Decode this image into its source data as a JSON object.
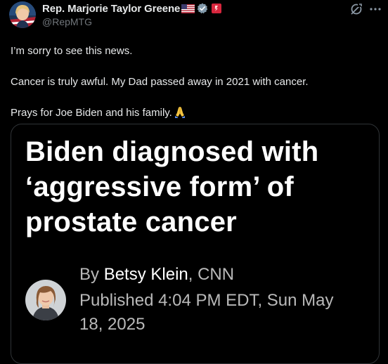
{
  "tweet": {
    "author": {
      "display_name": "Rep. Marjorie Taylor Greene",
      "handle": "@RepMTG",
      "badges": [
        "us-flag-icon",
        "verified-gray-icon",
        "government-affiliate-icon"
      ]
    },
    "actions": {
      "grok_icon": "grok-icon",
      "more_icon": "more-horizontal-icon"
    },
    "text_lines": [
      "I’m sorry to see this news.",
      "Cancer is truly awful.  My Dad passed away in 2021 with cancer.",
      "Prays for Joe Biden and his family."
    ],
    "emoji": "folded-hands-icon"
  },
  "card": {
    "headline_lines": [
      "Biden diagnosed with",
      "‘aggressive form’ of",
      "prostate cancer"
    ],
    "byline_prefix": "By ",
    "author_name": "Betsy Klein",
    "outlet": ", CNN",
    "published_lines": [
      "Published 4:04 PM EDT, Sun May",
      "18, 2025"
    ]
  },
  "colors": {
    "background": "#000000",
    "text_primary": "#e7e9ea",
    "text_secondary": "#71767b",
    "card_border": "#2f3336",
    "headline": "#ffffff",
    "byline": "#b9b9b9"
  }
}
